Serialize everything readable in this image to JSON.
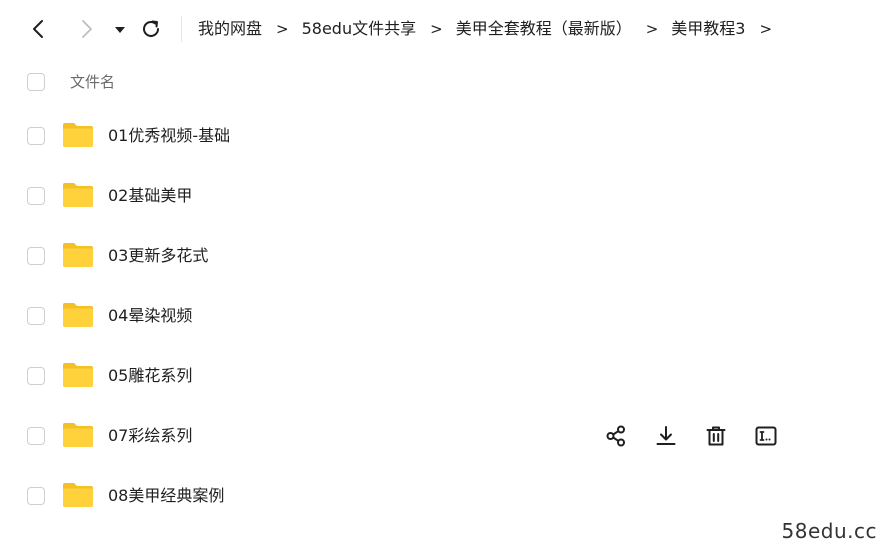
{
  "toolbar": {
    "back_icon": "chevron-left-icon",
    "forward_icon": "chevron-right-icon",
    "history_icon": "caret-down-icon",
    "refresh_icon": "refresh-icon"
  },
  "breadcrumb": {
    "separator": ">",
    "items": [
      {
        "label": "我的网盘"
      },
      {
        "label": "58edu文件共享"
      },
      {
        "label": "美甲全套教程（最新版）"
      },
      {
        "label": "美甲教程3"
      }
    ]
  },
  "list_header": {
    "name_label": "文件名"
  },
  "files": [
    {
      "name": "01优秀视频-基础",
      "type": "folder"
    },
    {
      "name": "02基础美甲",
      "type": "folder"
    },
    {
      "name": "03更新多花式",
      "type": "folder"
    },
    {
      "name": "04晕染视频",
      "type": "folder"
    },
    {
      "name": "05雕花系列",
      "type": "folder"
    },
    {
      "name": "07彩绘系列",
      "type": "folder",
      "hovered": true
    },
    {
      "name": "08美甲经典案例",
      "type": "folder"
    }
  ],
  "row_actions": [
    {
      "icon": "share-icon"
    },
    {
      "icon": "download-icon"
    },
    {
      "icon": "delete-icon"
    },
    {
      "icon": "rename-icon"
    }
  ],
  "colors": {
    "folder": "#FFD23C",
    "folder_back": "#F5C026",
    "text": "#1F1F1F",
    "muted": "#6B6B6B",
    "checkbox_border": "#CFCFCF"
  },
  "watermark": "58edu.cc"
}
